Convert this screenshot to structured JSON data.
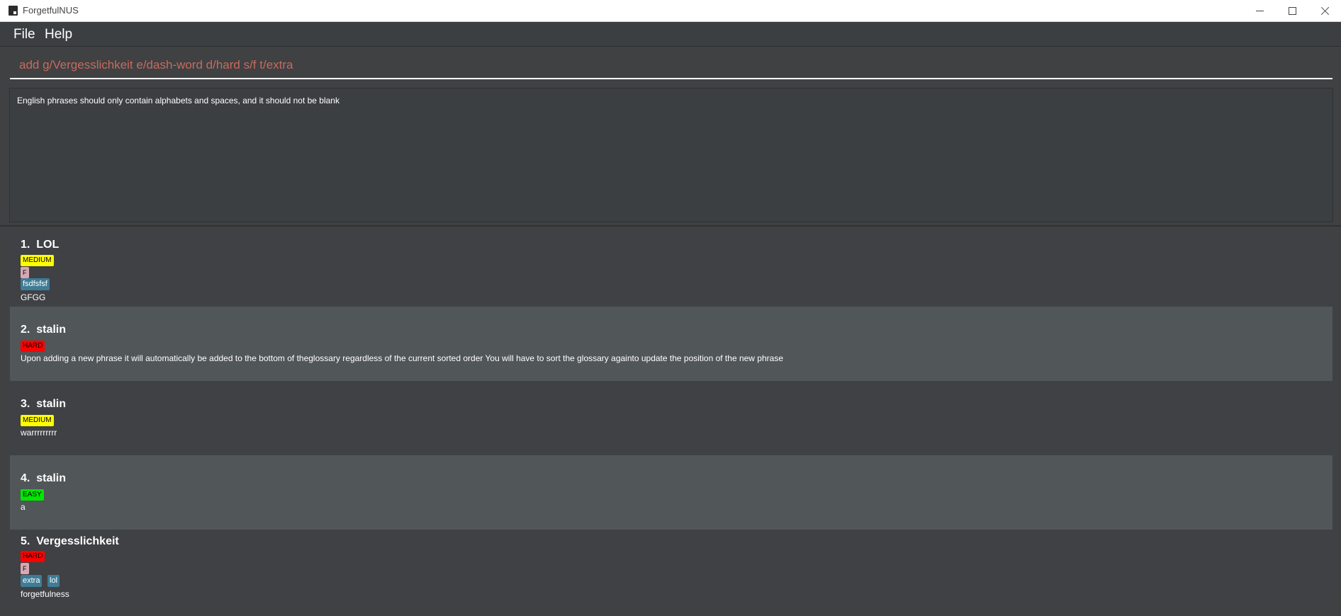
{
  "window": {
    "title": "ForgetfulNUS"
  },
  "menu": {
    "file": "File",
    "help": "Help"
  },
  "command": {
    "value": "add g/Vergesslichkeit e/dash-word d/hard s/f t/extra"
  },
  "result": {
    "message": "English phrases should only contain alphabets and spaces, and it should not be blank"
  },
  "glossary": [
    {
      "index": "1.",
      "phrase": "LOL",
      "difficulty": "MEDIUM",
      "language": "F",
      "tags": [
        "fsdfsfsf"
      ],
      "meaning": "GFGG"
    },
    {
      "index": "2.",
      "phrase": "stalin",
      "difficulty": "HARD",
      "language": "",
      "tags": [],
      "meaning": "Upon adding a new phrase it will automatically be added to the bottom of theglossary regardless of the current sorted order You will have to sort the glossary againto update the position of the new phrase"
    },
    {
      "index": "3.",
      "phrase": "stalin",
      "difficulty": "MEDIUM",
      "language": "",
      "tags": [],
      "meaning": "warrrrrrrrr"
    },
    {
      "index": "4.",
      "phrase": "stalin",
      "difficulty": "EASY",
      "language": "",
      "tags": [],
      "meaning": "a"
    },
    {
      "index": "5.",
      "phrase": "Vergesslichkeit",
      "difficulty": "HARD",
      "language": "F",
      "tags": [
        "extra",
        "lol"
      ],
      "meaning": "forgetfulness"
    }
  ]
}
